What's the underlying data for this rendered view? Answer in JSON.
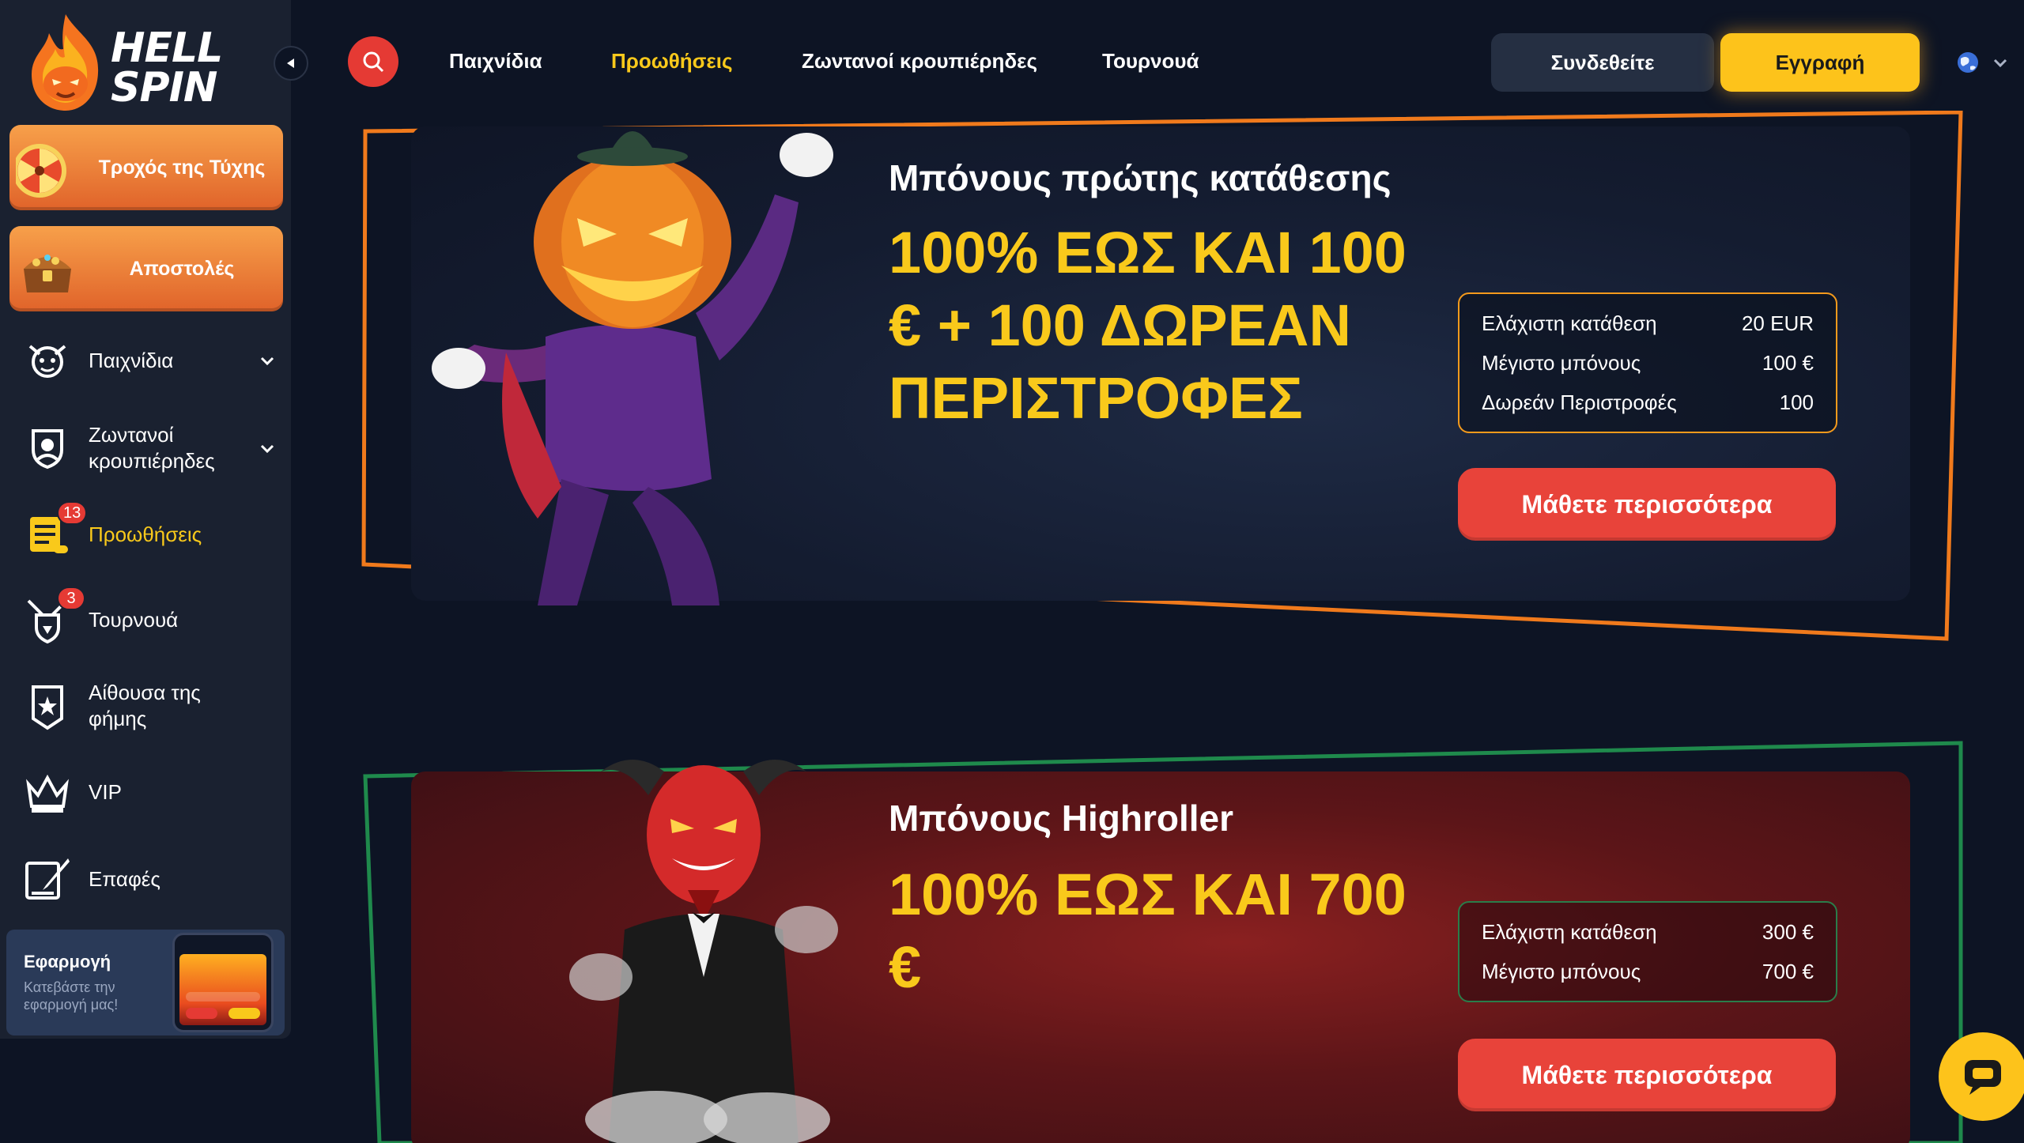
{
  "brand": {
    "logo_line1": "HELL",
    "logo_line2": "SPIN"
  },
  "header": {
    "nav": [
      "Παιχνίδια",
      "Προωθήσεις",
      "Ζωντανοί κρουπιέρηδες",
      "Τουρνουά"
    ],
    "active_nav": "Προωθήσεις",
    "login_label": "Συνδεθείτε",
    "register_label": "Εγγραφή"
  },
  "sidebar": {
    "wheel_label": "Τροχός της Τύχης",
    "missions_label": "Αποστολές",
    "items": [
      {
        "label": "Παιχνίδια",
        "icon": "demon-icon",
        "expandable": true
      },
      {
        "label": "Ζωντανοί κρουπιέρηδες",
        "icon": "dealer-icon",
        "expandable": true
      },
      {
        "label": "Προωθήσεις",
        "icon": "scroll-icon",
        "badge": "13",
        "active": true
      },
      {
        "label": "Τουρνουά",
        "icon": "swords-shield-icon",
        "badge": "3"
      },
      {
        "label": "Αίθουσα της φήμης",
        "icon": "banner-icon"
      },
      {
        "label": "VIP",
        "icon": "crown-icon"
      },
      {
        "label": "Επαφές",
        "icon": "contact-icon"
      }
    ],
    "app": {
      "title": "Εφαρμογή",
      "subtitle": "Κατεβάστε την εφαρμογή μας!"
    }
  },
  "promotions": [
    {
      "title": "Μπόνους πρώτης κατάθεσης",
      "headline": "100% ΕΩΣ ΚΑΙ 100 € + 100 ΔΩΡΕΑΝ ΠΕΡΙΣΤΡΟΦΕΣ",
      "details": [
        {
          "label": "Ελάχιστη κατάθεση",
          "value": "20 EUR"
        },
        {
          "label": "Μέγιστο μπόνους",
          "value": "100 €"
        },
        {
          "label": "Δωρεάν Περιστροφές",
          "value": "100"
        }
      ],
      "button": "Μάθετε περισσότερα",
      "frame_color": "#f07a1c"
    },
    {
      "title": "Μπόνους Highroller",
      "headline": "100% ΕΩΣ ΚΑΙ 700 €",
      "details": [
        {
          "label": "Ελάχιστη κατάθεση",
          "value": "300 €"
        },
        {
          "label": "Μέγιστο μπόνους",
          "value": "700 €"
        }
      ],
      "button": "Μάθετε περισσότερα",
      "frame_color": "#1f8a4c"
    }
  ],
  "colors": {
    "accent_yellow": "#f9c91b",
    "accent_red": "#e8433a",
    "bg": "#0d1424",
    "sidebar_bg": "#1a2130"
  }
}
